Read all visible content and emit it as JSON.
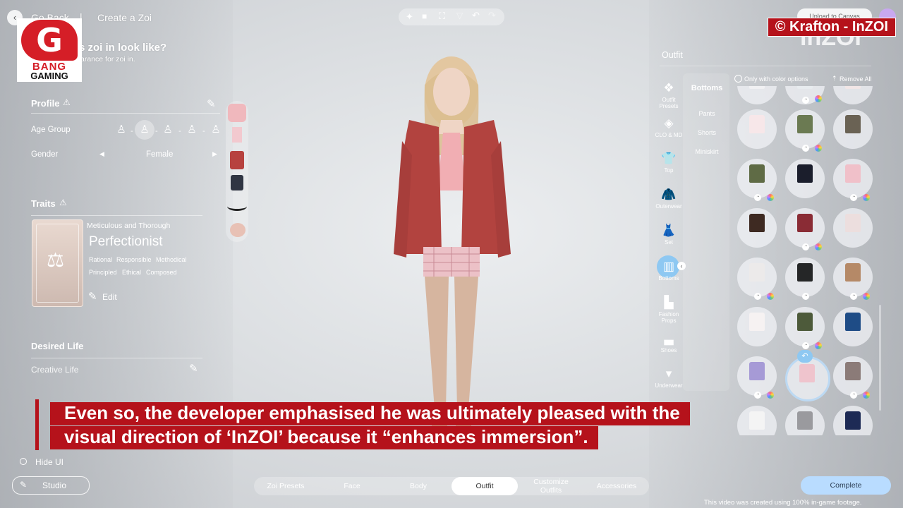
{
  "watermark": {
    "logo_line1": "BANG",
    "logo_line2": "GAMING",
    "logo_letter": "G",
    "credit": "© Krafton - InZOI"
  },
  "header": {
    "back": "Go Back",
    "separator": "|",
    "title": "Create a Zoi",
    "question": "s zoi in look like?",
    "subquestion": "arance for zoi in.",
    "upload": "Upload to Canvas",
    "brand": "inZOI"
  },
  "profile": {
    "title": "Profile",
    "age_label": "Age Group",
    "gender_label": "Gender",
    "gender_value": "Female"
  },
  "traits": {
    "title": "Traits",
    "subtitle": "Meticulous and Thorough",
    "name": "Perfectionist",
    "tags_row1": [
      "Rational",
      "Responsible",
      "Methodical"
    ],
    "tags_row2": [
      "Principled",
      "Ethical",
      "Composed"
    ],
    "edit": "Edit"
  },
  "desired_life": {
    "title": "Desired Life",
    "value": "Creative Life"
  },
  "bottom_left": {
    "hide_ui": "Hide UI",
    "studio": "Studio"
  },
  "tabs": [
    "Zoi Presets",
    "Face",
    "Body",
    "Outfit",
    "Customize Outfits",
    "Accessories"
  ],
  "active_tab": "Outfit",
  "complete": "Complete",
  "footnote": "This video was created using 100% in-game footage.",
  "outfit": {
    "title": "Outfit",
    "only_color": "Only with color options",
    "remove_all": "Remove All",
    "categories": [
      "Outfit Presets",
      "CLO & MD",
      "Top",
      "Outerwear",
      "Set",
      "Bottoms",
      "Fashion Props",
      "Shoes",
      "Underwear"
    ],
    "sub_title": "Bottoms",
    "sub_items": [
      "Pants",
      "Shorts",
      "Miniskirt"
    ]
  },
  "subtitle": {
    "line1": "Even so, the developer emphasised he was ultimately pleased with the",
    "line2": "visual direction of ‘InZOI’ because it “enhances immersion”."
  },
  "colors": {
    "accent_red": "#b5121b",
    "complete_blue": "#b9dcff",
    "active_cat": "#8ec8f2"
  }
}
